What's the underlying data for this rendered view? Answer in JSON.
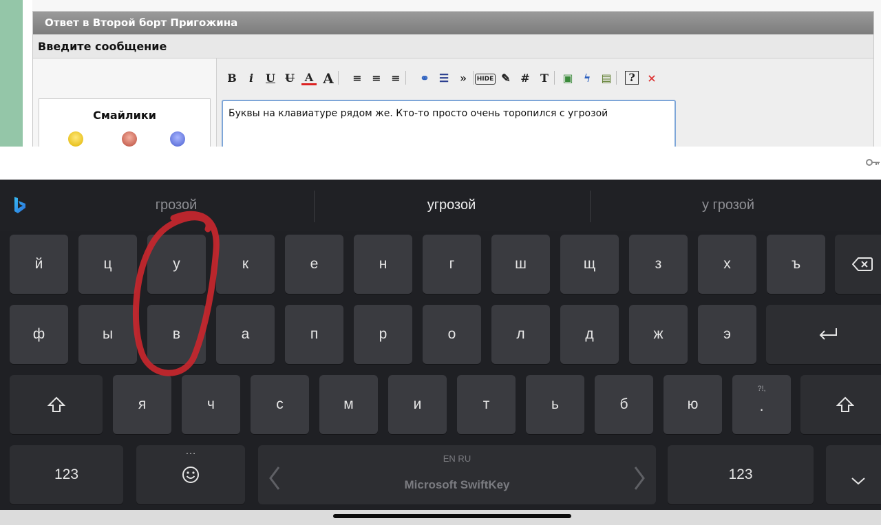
{
  "forum": {
    "header_title": "Ответ в Второй борт Пригожина",
    "subheader": "Введите сообщение",
    "smilies_title": "Смайлики",
    "editor_text": "Буквы на клавиатуре рядом же. Кто-то просто очень торопился с угрозой",
    "toolbar": [
      {
        "label": "B",
        "icon": "bold-icon"
      },
      {
        "label": "i",
        "icon": "italic-icon"
      },
      {
        "label": "U",
        "icon": "underline-icon"
      },
      {
        "label": "U",
        "icon": "strikethrough-icon"
      },
      {
        "label": "A",
        "icon": "text-color-icon"
      },
      {
        "label": "A",
        "icon": "font-size-icon"
      },
      {
        "label": "≡",
        "icon": "align-left-icon"
      },
      {
        "label": "≡",
        "icon": "align-center-icon"
      },
      {
        "label": "≡",
        "icon": "align-right-icon"
      },
      {
        "label": "⚭",
        "icon": "link-icon"
      },
      {
        "label": "☰",
        "icon": "list-icon"
      },
      {
        "label": "»",
        "icon": "quote-icon"
      },
      {
        "label": "HIDE",
        "icon": "hide-icon"
      },
      {
        "label": "✎",
        "icon": "edit-icon"
      },
      {
        "label": "#",
        "icon": "code-icon"
      },
      {
        "label": "T",
        "icon": "font-icon"
      },
      {
        "label": "▣",
        "icon": "image-icon"
      },
      {
        "label": "ϟ",
        "icon": "flash-icon"
      },
      {
        "label": "▤",
        "icon": "video-icon"
      },
      {
        "label": "?",
        "icon": "help-icon"
      },
      {
        "label": "×",
        "icon": "close-icon"
      }
    ]
  },
  "suggestions": [
    "грозой",
    "угрозой",
    "у грозой"
  ],
  "keyboard": {
    "row1": [
      "й",
      "ц",
      "у",
      "к",
      "е",
      "н",
      "г",
      "ш",
      "щ",
      "з",
      "х",
      "ъ"
    ],
    "row2": [
      "ф",
      "ы",
      "в",
      "а",
      "п",
      "р",
      "о",
      "л",
      "д",
      "ж",
      "э"
    ],
    "row3": [
      "я",
      "ч",
      "с",
      "м",
      "и",
      "т",
      "ь",
      "б",
      "ю"
    ],
    "punct_key": {
      "hint": "?!,",
      "main": "."
    },
    "numbers_label": "123",
    "emoji_more": "…",
    "space_lang": "EN RU",
    "space_brand": "Microsoft SwiftKey"
  },
  "colors": {
    "keyboard_bg": "#1f2024",
    "key_bg": "#3a3b40",
    "key_dark_bg": "#2d2e32",
    "forum_header": "#8a8a8a",
    "annotation": "#c8272e"
  }
}
